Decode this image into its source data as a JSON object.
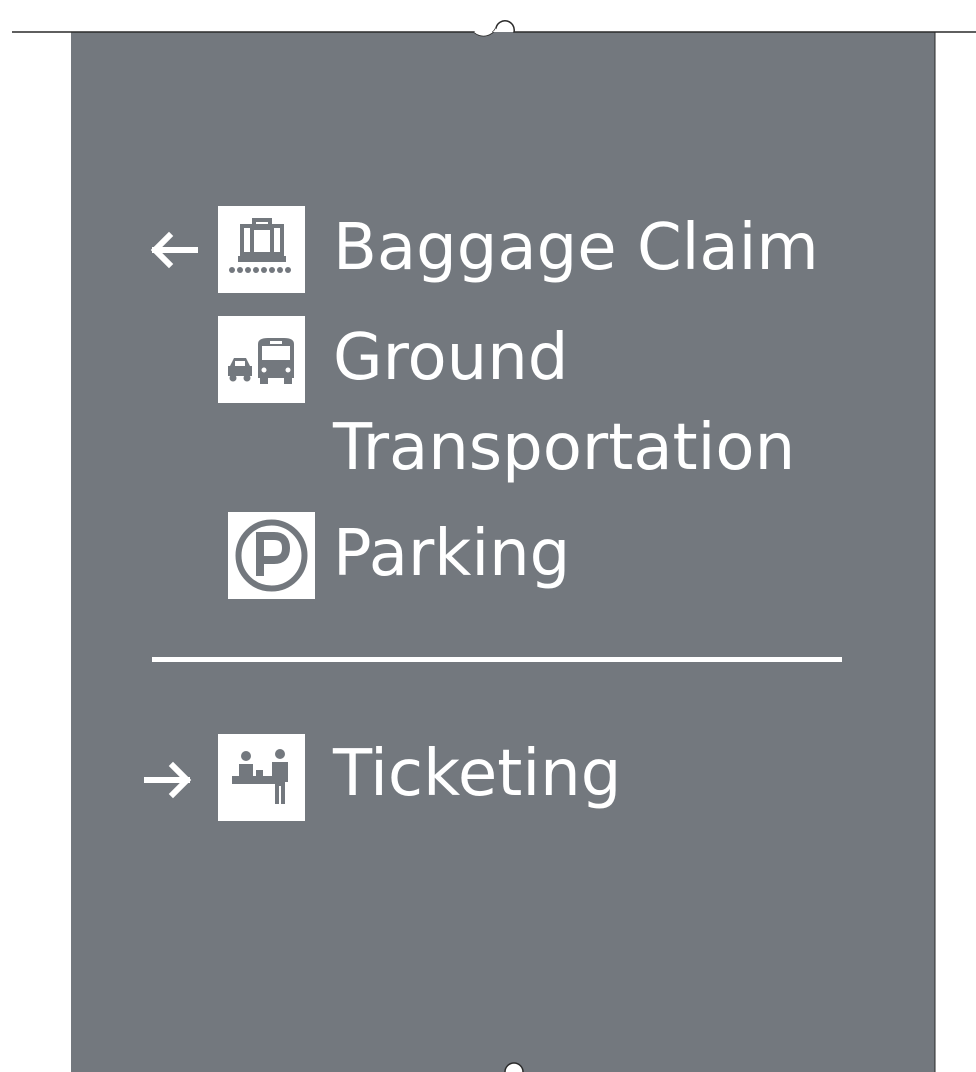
{
  "colors": {
    "sign_background": "#73787e",
    "foreground": "#ffffff",
    "outline": "#2a2a2a"
  },
  "rows": [
    {
      "arrow": "arrow-left-icon",
      "icon": "baggage-claim-icon",
      "label": "Baggage Claim"
    },
    {
      "arrow": "",
      "icon": "ground-transportation-icon",
      "label_lines": [
        "Ground",
        "Transportation"
      ]
    },
    {
      "arrow": "",
      "icon": "parking-icon",
      "label": "Parking"
    },
    {
      "arrow": "arrow-right-icon",
      "icon": "ticketing-icon",
      "label": "Ticketing"
    }
  ]
}
